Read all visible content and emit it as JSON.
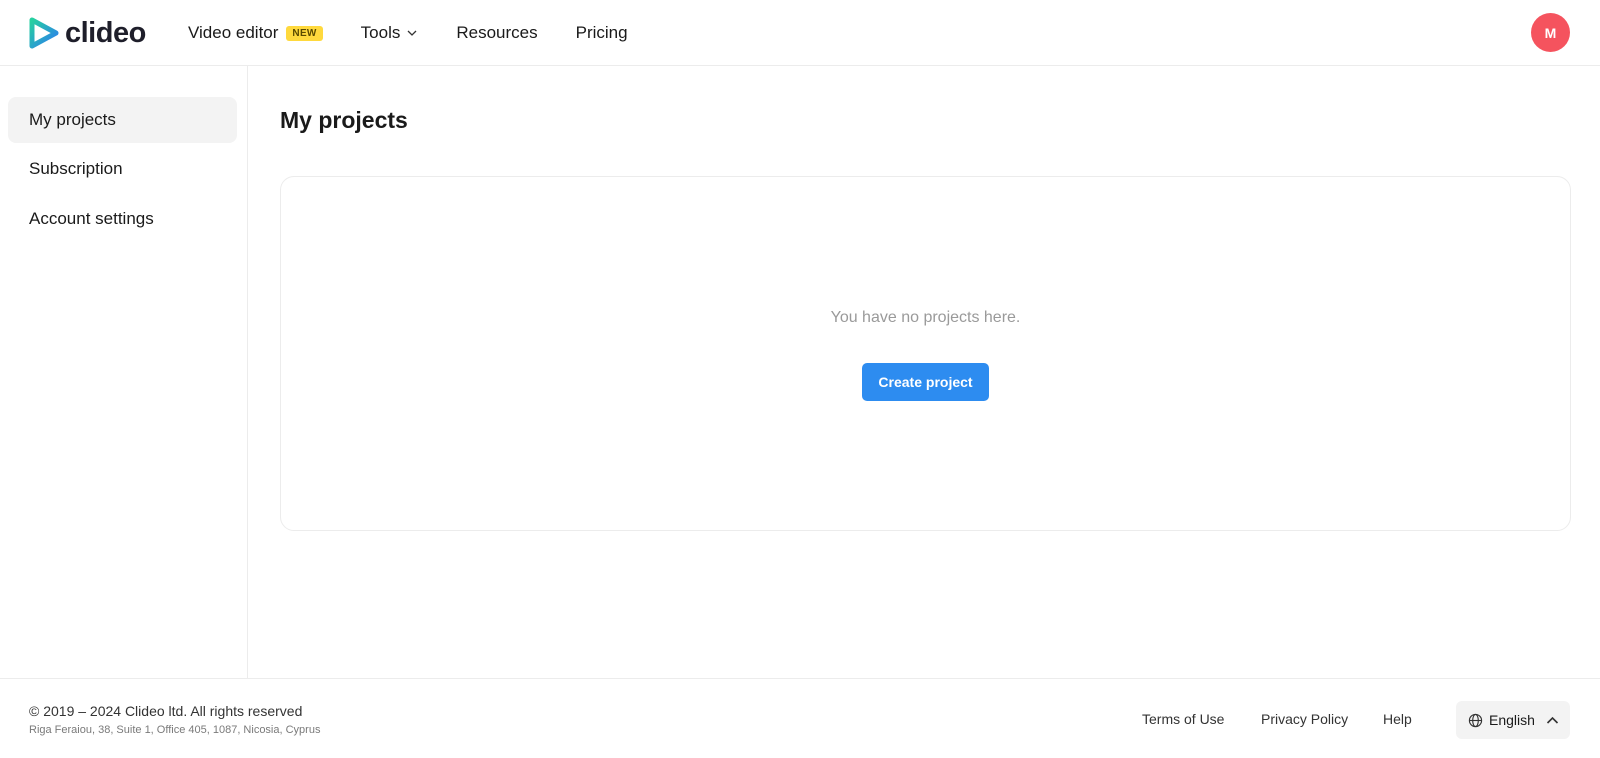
{
  "brand": {
    "name": "clideo",
    "accent": "#2d8cf0",
    "logo_gradient": [
      "#26d0a0",
      "#2d7cf0"
    ]
  },
  "nav": {
    "video_editor": "Video editor",
    "new_badge": "NEW",
    "tools": "Tools",
    "resources": "Resources",
    "pricing": "Pricing"
  },
  "user": {
    "initial": "M",
    "avatar_color": "#f5535e"
  },
  "sidebar": {
    "items": [
      {
        "label": "My projects",
        "active": true
      },
      {
        "label": "Subscription",
        "active": false
      },
      {
        "label": "Account settings",
        "active": false
      }
    ]
  },
  "main": {
    "title": "My projects",
    "empty_message": "You have no projects here.",
    "create_button": "Create project"
  },
  "footer": {
    "copyright": "© 2019 – 2024 Clideo ltd. All rights reserved",
    "address": "Riga Feraiou, 38, Suite 1, Office 405, 1087, Nicosia, Cyprus",
    "links": [
      "Terms of Use",
      "Privacy Policy",
      "Help"
    ],
    "language": "English"
  },
  "icons": [
    "play-logo-icon",
    "chevron-down-icon",
    "globe-icon",
    "chevron-up-icon"
  ]
}
